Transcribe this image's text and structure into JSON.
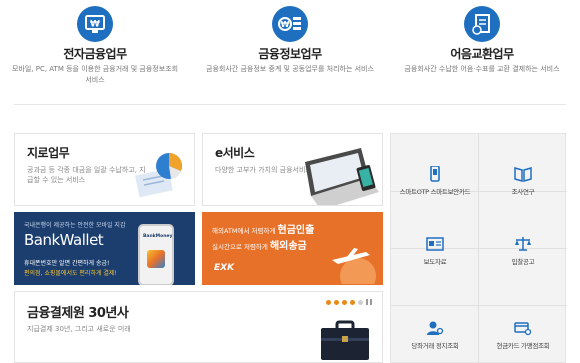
{
  "services": [
    {
      "title": "전자금융업무",
      "desc": "모바일, PC, ATM 등을 이용한 금융거래 및 금융정보조회 서비스",
      "icon": "monitor-won-icon"
    },
    {
      "title": "금융정보업무",
      "desc": "금융회사간 금융정보 중계 및 공동업무를 처리하는 서비스",
      "icon": "coin-stack-won-icon"
    },
    {
      "title": "어음교환업무",
      "desc": "금융회사간 수납한 어음·수표를 교환 결제하는 서비스",
      "icon": "document-exchange-icon"
    }
  ],
  "giro": {
    "title": "지로업무",
    "desc": "공과금 등 각종 대금을 일괄 수납하고, 지급할 수 있는 서비스"
  },
  "eservice": {
    "title": "e서비스",
    "desc": "다양한 고부가 가치의 금융서비스"
  },
  "bankwallet": {
    "top": "국내은행이 제공하는 안전한 모바일 지갑",
    "brand": "BankWallet",
    "line1": "휴대폰번호만 알면 간편하게 송금!",
    "line2": "편의점, 쇼핑몰에서도 편리하게 결제!",
    "badge": "BankMoney"
  },
  "exk": {
    "line1_pre": "해외ATM에서 저렴하게 ",
    "line1_hl": "현금인출",
    "line2_pre": "실시간으로 저렴하게 ",
    "line2_hl": "해외송금",
    "logo": "EXK"
  },
  "history": {
    "title": "금융결제원 30년사",
    "desc": "지급결제 30년, 그리고 새로운 미래"
  },
  "side": [
    {
      "label": "스마트OTP 스마트보안카드",
      "icon": "phone-otp-icon"
    },
    {
      "label": "조사연구",
      "icon": "book-icon"
    },
    {
      "label": "보도자료",
      "icon": "newspaper-icon"
    },
    {
      "label": "입찰공고",
      "icon": "scale-icon"
    },
    {
      "label": "당좌거래 정지조회",
      "icon": "person-search-icon"
    },
    {
      "label": "현금카드 가맹점조회",
      "icon": "card-search-icon"
    }
  ],
  "colors": {
    "accent": "#1e6fc0",
    "bankwallet": "#1b3e6e",
    "exk": "#e8712a",
    "highlight": "#f6c12e"
  }
}
